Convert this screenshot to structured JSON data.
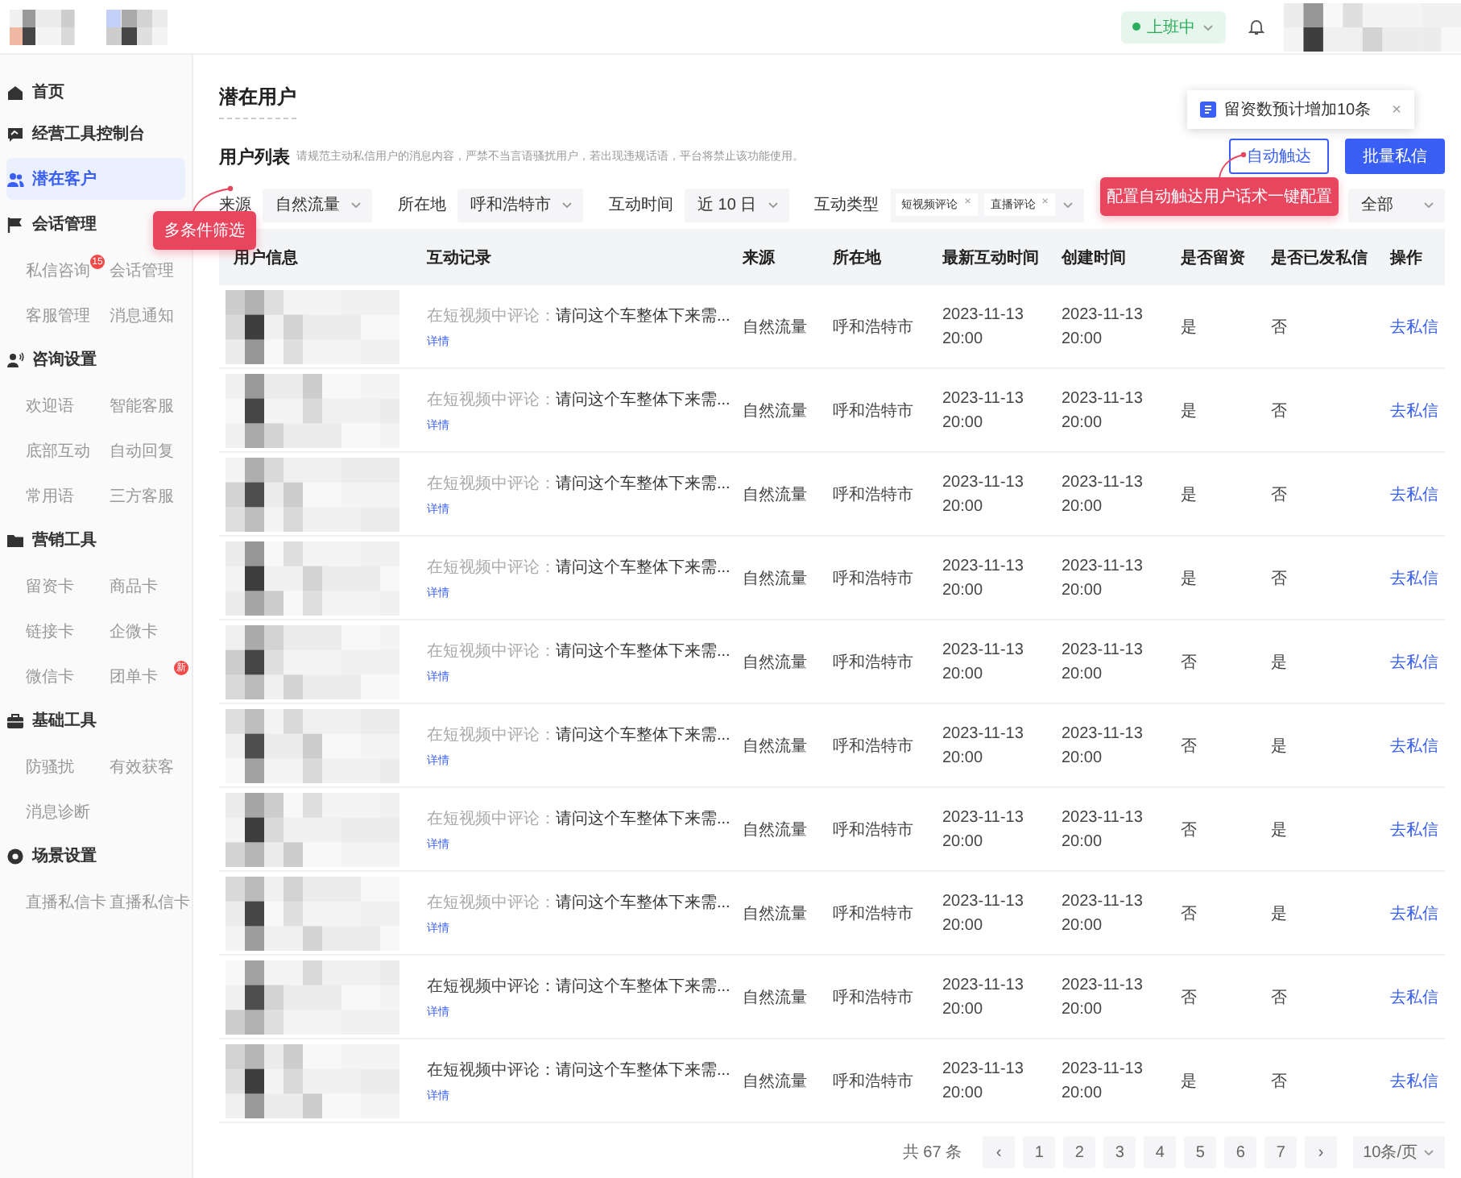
{
  "topbar": {
    "status": {
      "label": "上班中",
      "online": true
    }
  },
  "sidebar": {
    "items": [
      {
        "label": "首页",
        "selected": false
      },
      {
        "label": "经营工具控制台",
        "selected": false
      },
      {
        "label": "潜在客户",
        "selected": true
      },
      {
        "label": "会话管理",
        "selected": false,
        "children": [
          {
            "label": "私信咨询",
            "badge": "15"
          },
          {
            "label": "会话管理"
          },
          {
            "label": "客服管理"
          },
          {
            "label": "消息通知"
          }
        ]
      },
      {
        "label": "咨询设置",
        "selected": false,
        "children": [
          {
            "label": "欢迎语"
          },
          {
            "label": "智能客服"
          },
          {
            "label": "底部互动"
          },
          {
            "label": "自动回复"
          },
          {
            "label": "常用语"
          },
          {
            "label": "三方客服"
          }
        ]
      },
      {
        "label": "营销工具",
        "selected": false,
        "children": [
          {
            "label": "留资卡"
          },
          {
            "label": "商品卡"
          },
          {
            "label": "链接卡"
          },
          {
            "label": "企微卡"
          },
          {
            "label": "微信卡"
          },
          {
            "label": "团单卡",
            "badge": "新"
          }
        ]
      },
      {
        "label": "基础工具",
        "selected": false,
        "children": [
          {
            "label": "防骚扰"
          },
          {
            "label": "有效获客"
          },
          {
            "label": "消息诊断"
          }
        ]
      },
      {
        "label": "场景设置",
        "selected": false,
        "children": [
          {
            "label": "直播私信卡"
          },
          {
            "label": "直播私信卡"
          }
        ]
      }
    ]
  },
  "page_title": "潜在用户",
  "tip": {
    "text": "留资数预计增加10条",
    "close": "×"
  },
  "list_title": "用户列表",
  "notice": "请规范主动私信用户的消息内容，严禁不当言语骚扰用户，若出现违规话语，平台将禁止该功能使用。",
  "buttons": [
    {
      "label": "自动触达",
      "kind": "outline"
    },
    {
      "label": "批量私信",
      "kind": "primary"
    }
  ],
  "filters": [
    {
      "kind": "select",
      "label": "来源",
      "value": "自然流量"
    },
    {
      "kind": "select",
      "label": "所在地",
      "value": "呼和浩特市"
    },
    {
      "kind": "select",
      "label": "互动时间",
      "value": "近 10 日"
    },
    {
      "kind": "tags",
      "label": "互动类型",
      "tags": [
        {
          "label": "短视频评论",
          "remove": "×"
        },
        {
          "label": "直播评论",
          "remove": "×"
        }
      ]
    },
    {
      "kind": "select",
      "value": "全部"
    }
  ],
  "callouts": [
    {
      "text": "多条件筛选"
    },
    {
      "text": "配置自动触达用户话术一键配置"
    }
  ],
  "table": {
    "columns": [
      "用户信息",
      "互动记录",
      "来源",
      "所在地",
      "最新互动时间",
      "创建时间",
      "是否留资",
      "是否已发私信",
      "操作"
    ],
    "rows": [
      {
        "read": true,
        "record_prefix": "在短视频中评论：",
        "record": "请问这个车整体下来需...",
        "detail": "详情",
        "source": "自然流量",
        "location": "呼和浩特市",
        "latest": [
          "2023-11-13",
          "20:00"
        ],
        "created": [
          "2023-11-13",
          "20:00"
        ],
        "lead": "是",
        "messaged": "否",
        "action": "去私信"
      },
      {
        "read": true,
        "record_prefix": "在短视频中评论：",
        "record": "请问这个车整体下来需...",
        "detail": "详情",
        "source": "自然流量",
        "location": "呼和浩特市",
        "latest": [
          "2023-11-13",
          "20:00"
        ],
        "created": [
          "2023-11-13",
          "20:00"
        ],
        "lead": "是",
        "messaged": "否",
        "action": "去私信"
      },
      {
        "read": true,
        "record_prefix": "在短视频中评论：",
        "record": "请问这个车整体下来需...",
        "detail": "详情",
        "source": "自然流量",
        "location": "呼和浩特市",
        "latest": [
          "2023-11-13",
          "20:00"
        ],
        "created": [
          "2023-11-13",
          "20:00"
        ],
        "lead": "是",
        "messaged": "否",
        "action": "去私信"
      },
      {
        "read": true,
        "record_prefix": "在短视频中评论：",
        "record": "请问这个车整体下来需...",
        "detail": "详情",
        "source": "自然流量",
        "location": "呼和浩特市",
        "latest": [
          "2023-11-13",
          "20:00"
        ],
        "created": [
          "2023-11-13",
          "20:00"
        ],
        "lead": "是",
        "messaged": "否",
        "action": "去私信"
      },
      {
        "read": true,
        "record_prefix": "在短视频中评论：",
        "record": "请问这个车整体下来需...",
        "detail": "详情",
        "source": "自然流量",
        "location": "呼和浩特市",
        "latest": [
          "2023-11-13",
          "20:00"
        ],
        "created": [
          "2023-11-13",
          "20:00"
        ],
        "lead": "否",
        "messaged": "是",
        "action": "去私信"
      },
      {
        "read": true,
        "record_prefix": "在短视频中评论：",
        "record": "请问这个车整体下来需...",
        "detail": "详情",
        "source": "自然流量",
        "location": "呼和浩特市",
        "latest": [
          "2023-11-13",
          "20:00"
        ],
        "created": [
          "2023-11-13",
          "20:00"
        ],
        "lead": "否",
        "messaged": "是",
        "action": "去私信"
      },
      {
        "read": true,
        "record_prefix": "在短视频中评论：",
        "record": "请问这个车整体下来需...",
        "detail": "详情",
        "source": "自然流量",
        "location": "呼和浩特市",
        "latest": [
          "2023-11-13",
          "20:00"
        ],
        "created": [
          "2023-11-13",
          "20:00"
        ],
        "lead": "否",
        "messaged": "是",
        "action": "去私信"
      },
      {
        "read": true,
        "record_prefix": "在短视频中评论：",
        "record": "请问这个车整体下来需...",
        "detail": "详情",
        "source": "自然流量",
        "location": "呼和浩特市",
        "latest": [
          "2023-11-13",
          "20:00"
        ],
        "created": [
          "2023-11-13",
          "20:00"
        ],
        "lead": "否",
        "messaged": "是",
        "action": "去私信"
      },
      {
        "read": false,
        "record_prefix": "在短视频中评论：",
        "record": "请问这个车整体下来需...",
        "detail": "详情",
        "source": "自然流量",
        "location": "呼和浩特市",
        "latest": [
          "2023-11-13",
          "20:00"
        ],
        "created": [
          "2023-11-13",
          "20:00"
        ],
        "lead": "否",
        "messaged": "否",
        "action": "去私信"
      },
      {
        "read": false,
        "record_prefix": "在短视频中评论：",
        "record": "请问这个车整体下来需...",
        "detail": "详情",
        "source": "自然流量",
        "location": "呼和浩特市",
        "latest": [
          "2023-11-13",
          "20:00"
        ],
        "created": [
          "2023-11-13",
          "20:00"
        ],
        "lead": "是",
        "messaged": "否",
        "action": "去私信"
      }
    ]
  },
  "pagination": {
    "total": "共 67 条",
    "prev": "‹",
    "next": "›",
    "pages": [
      {
        "label": "1",
        "selected": false
      },
      {
        "label": "2",
        "selected": false
      },
      {
        "label": "3",
        "selected": false
      },
      {
        "label": "4",
        "selected": false
      },
      {
        "label": "5",
        "selected": false
      },
      {
        "label": "6",
        "selected": false
      },
      {
        "label": "7",
        "selected": false
      }
    ],
    "page_size": "10条/页"
  }
}
